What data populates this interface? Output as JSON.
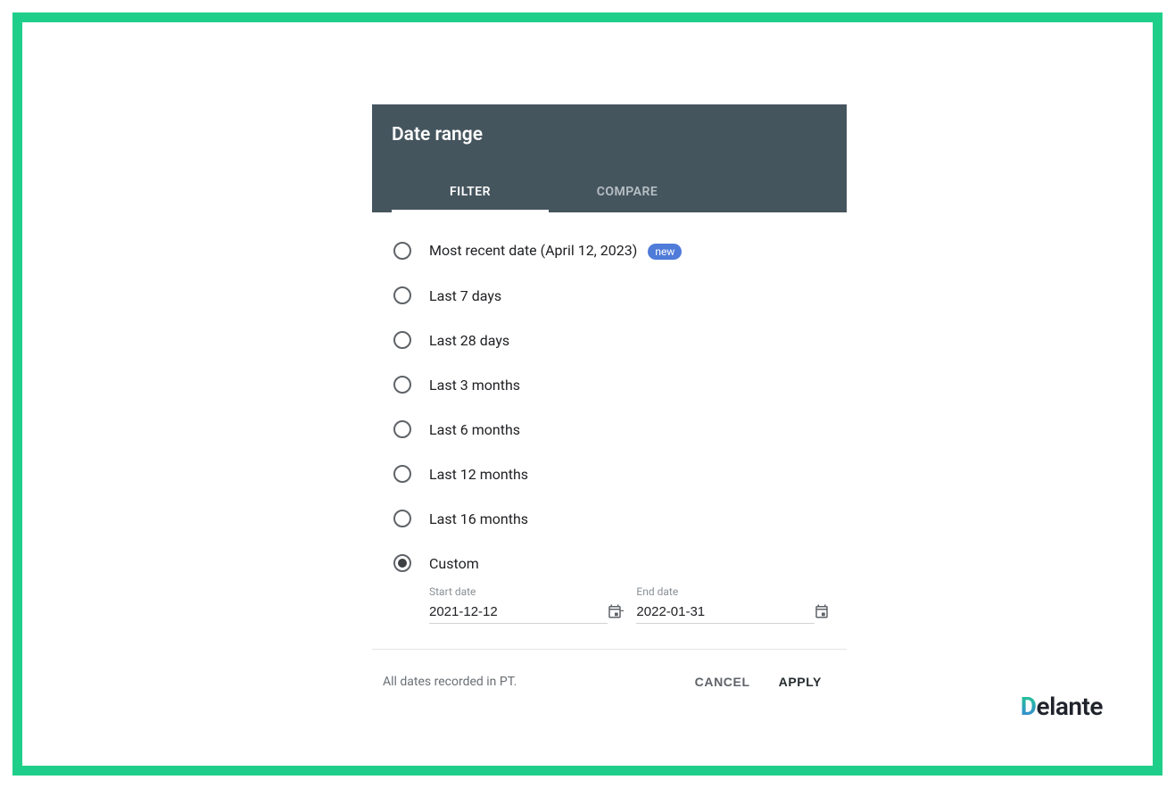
{
  "dialog": {
    "title": "Date range",
    "tabs": {
      "filter": "FILTER",
      "compare": "COMPARE"
    },
    "options": [
      {
        "id": "most-recent",
        "label": "Most recent date (April 12, 2023)",
        "badge": "new",
        "selected": false
      },
      {
        "id": "last-7-days",
        "label": "Last 7 days",
        "selected": false
      },
      {
        "id": "last-28-days",
        "label": "Last 28 days",
        "selected": false
      },
      {
        "id": "last-3-months",
        "label": "Last 3 months",
        "selected": false
      },
      {
        "id": "last-6-months",
        "label": "Last 6 months",
        "selected": false
      },
      {
        "id": "last-12-months",
        "label": "Last 12 months",
        "selected": false
      },
      {
        "id": "last-16-months",
        "label": "Last 16 months",
        "selected": false
      },
      {
        "id": "custom",
        "label": "Custom",
        "selected": true
      }
    ],
    "custom": {
      "start_label": "Start date",
      "start_value": "2021-12-12",
      "end_label": "End date",
      "end_value": "2022-01-31",
      "separator": "-"
    },
    "footer": {
      "note": "All dates recorded in PT.",
      "cancel": "CANCEL",
      "apply": "APPLY"
    }
  },
  "brand": {
    "logo_d": "D",
    "logo_rest": "elante"
  }
}
